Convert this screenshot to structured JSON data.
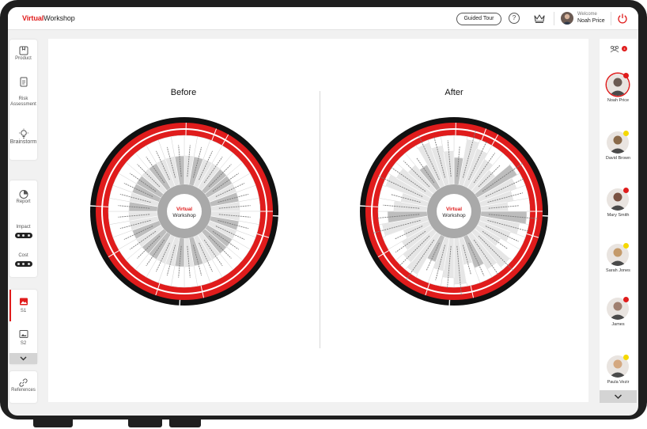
{
  "app": {
    "logo_first": "Virtual",
    "logo_second": "Workshop",
    "guided_tour_label": "Guided Tour",
    "help_label": "?",
    "welcome_label": "Welcome",
    "user_name": "Noah Price",
    "accent_color": "#e01c1c"
  },
  "left_nav": {
    "product_label": "Product",
    "risk_label": "Risk Assessment",
    "brainstorm_label": "Brainstorm",
    "report_label": "Report",
    "impact_label": "Impact",
    "cost_label": "Cost",
    "s1_label": "S1",
    "s2_label": "S2",
    "references_label": "References"
  },
  "main": {
    "before_title": "Before",
    "after_title": "After",
    "wheel_logo_first": "Virtual",
    "wheel_logo_second": "Workshop"
  },
  "participants": {
    "count": "4",
    "list": [
      {
        "name": "Noah Price",
        "badge_color": "#e01c1c"
      },
      {
        "name": "David Brown",
        "badge_color": "#f5d800"
      },
      {
        "name": "Mary Smith",
        "badge_color": "#e01c1c"
      },
      {
        "name": "Sarah Jones",
        "badge_color": "#f5d800"
      },
      {
        "name": "James",
        "badge_color": "#e01c1c"
      },
      {
        "name": "Paula Vezir",
        "badge_color": "#f5d800"
      }
    ]
  }
}
